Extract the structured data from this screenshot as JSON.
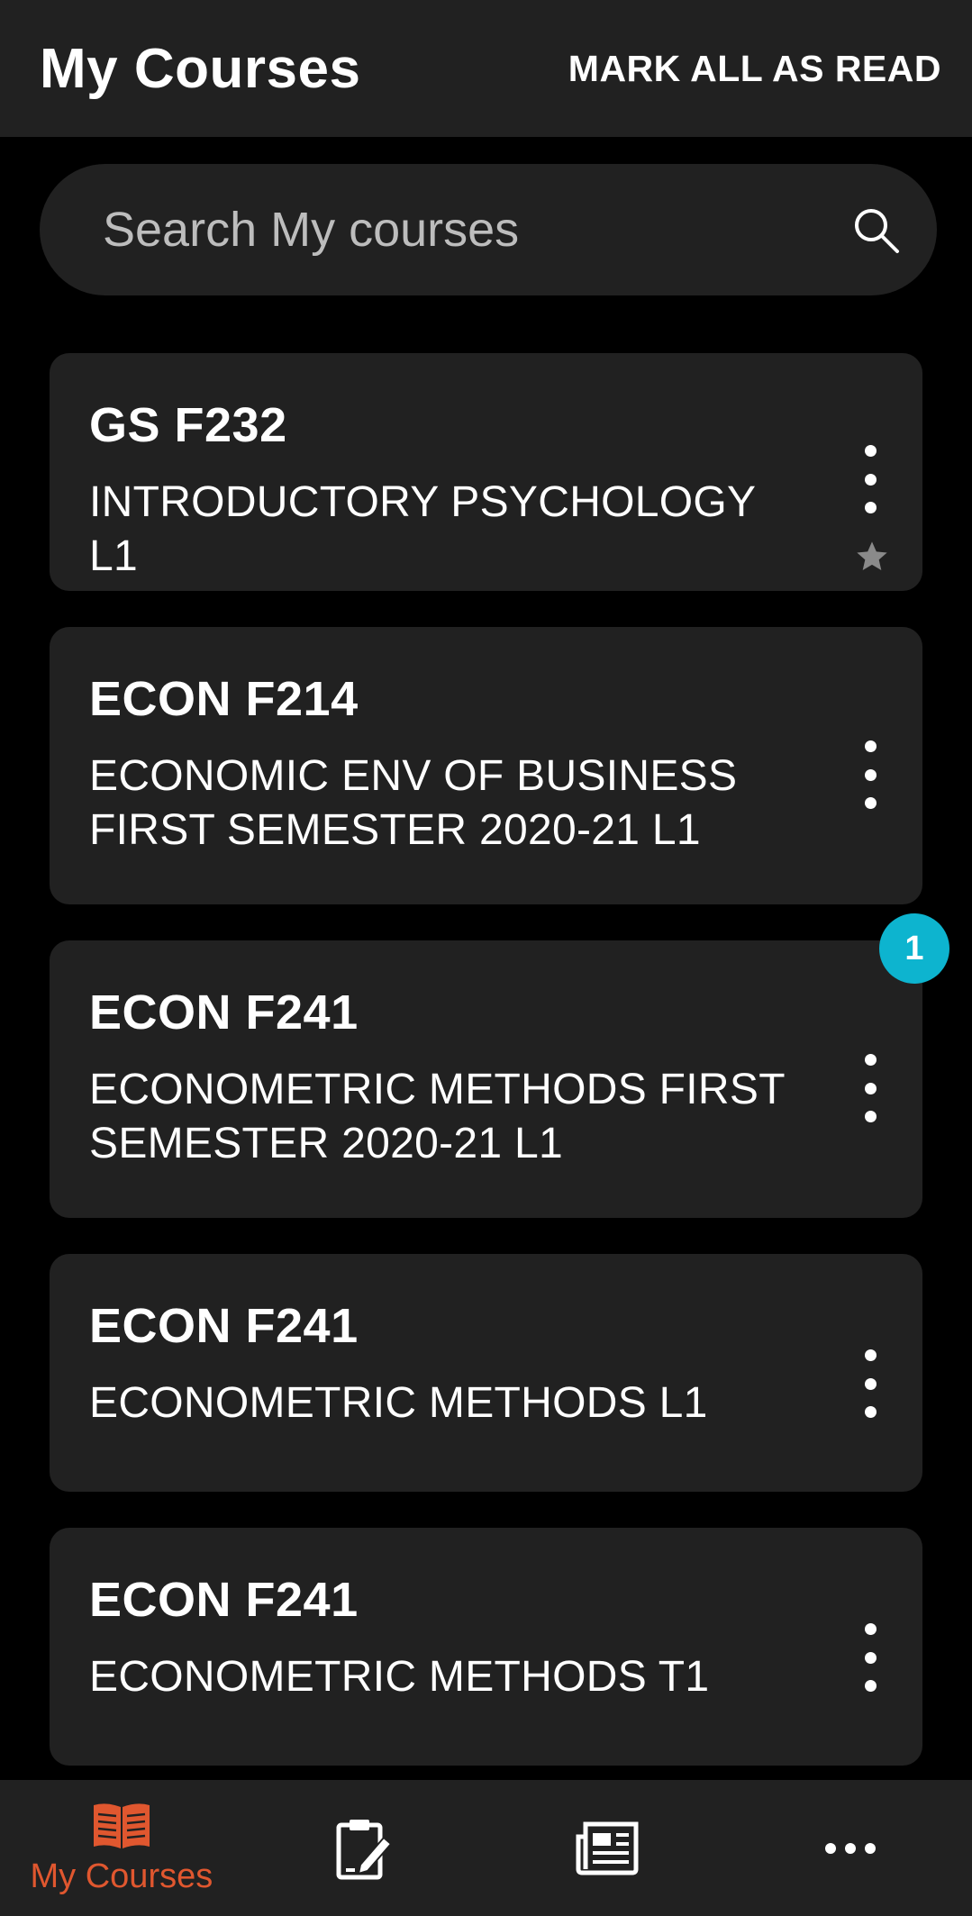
{
  "header": {
    "title": "My Courses",
    "mark_all_label": "MARK ALL AS READ"
  },
  "search": {
    "placeholder": "Search My courses",
    "icon": "search-icon"
  },
  "courses": [
    {
      "code": "GS F232",
      "name": "INTRODUCTORY PSYCHOLOGY L1",
      "starred": true,
      "badge": ""
    },
    {
      "code": "ECON F214",
      "name": "ECONOMIC ENV OF BUSINESS FIRST SEMESTER 2020-21 L1",
      "starred": false,
      "badge": ""
    },
    {
      "code": "ECON F241",
      "name": "ECONOMETRIC METHODS FIRST SEMESTER 2020-21 L1",
      "starred": false,
      "badge": "1"
    },
    {
      "code": "ECON F241",
      "name": "ECONOMETRIC METHODS L1",
      "starred": false,
      "badge": ""
    },
    {
      "code": "ECON F241",
      "name": "ECONOMETRIC METHODS T1",
      "starred": false,
      "badge": ""
    }
  ],
  "bottom_nav": {
    "items": [
      {
        "label": "My Courses",
        "icon": "open-book-icon",
        "active": true
      },
      {
        "label": "",
        "icon": "clipboard-edit-icon",
        "active": false
      },
      {
        "label": "",
        "icon": "newspaper-icon",
        "active": false
      },
      {
        "label": "",
        "icon": "more-horizontal-icon",
        "active": false
      }
    ]
  },
  "colors": {
    "background": "#000000",
    "surface": "#212121",
    "accent": "#e0572f",
    "badge": "#0db4cf",
    "star": "#8a8a8a"
  }
}
